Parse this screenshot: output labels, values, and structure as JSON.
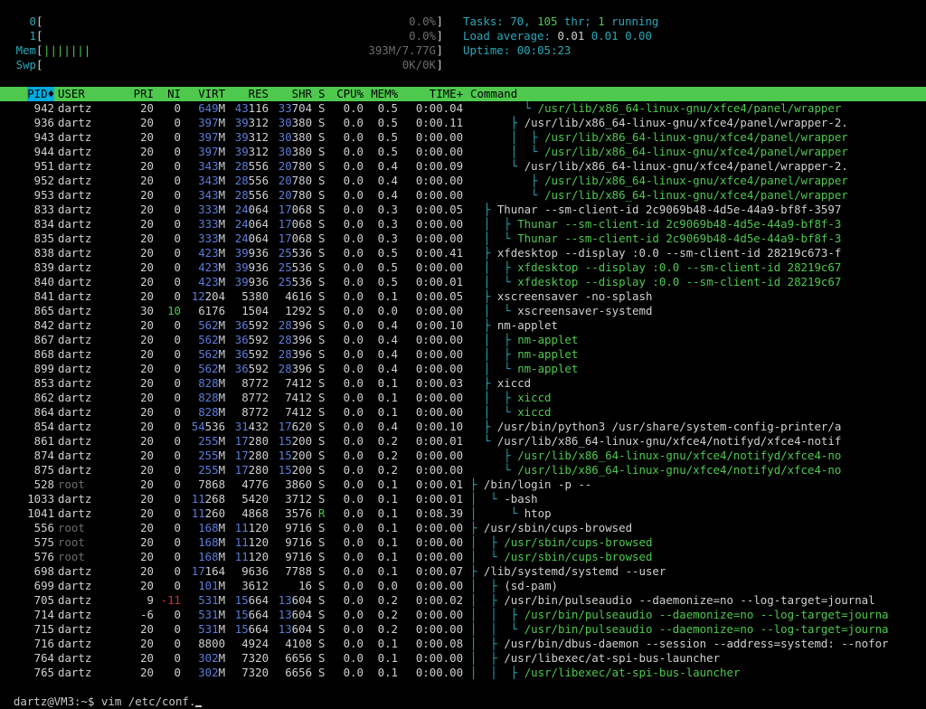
{
  "meters": [
    {
      "label": "0",
      "bar": "",
      "value": "0.0%"
    },
    {
      "label": "1",
      "bar": "",
      "value": "0.0%"
    },
    {
      "label": "Mem",
      "bar": "|||||||",
      "value": "393M/7.77G"
    },
    {
      "label": "Swp",
      "bar": "",
      "value": "0K/0K"
    }
  ],
  "summary": {
    "tasks_label": "Tasks: ",
    "tasks": "70",
    "thr": "105",
    "thr_label": " thr; ",
    "running": "1",
    "running_label": " running",
    "load_label": "Load average: ",
    "load1": "0.01",
    "load5": "0.01",
    "load15": "0.00",
    "uptime_label": "Uptime: ",
    "uptime": "00:05:23"
  },
  "columns": [
    "PID",
    "USER",
    "PRI",
    "NI",
    "VIRT",
    "RES",
    "SHR",
    "S",
    "CPU%",
    "MEM%",
    "TIME+",
    "Command"
  ],
  "sort_indicator": "♦",
  "processes": [
    {
      "pid": "942",
      "user": "dartz",
      "pri": "20",
      "ni": "0",
      "virt": "649M",
      "res": "43116",
      "shr": "33704",
      "s": "S",
      "cpu": "0.0",
      "mem": "0.5",
      "time": "0:00.04",
      "tree": "        └ ",
      "cmd": "/usr/lib/x86_64-linux-gnu/xfce4/panel/wrapper",
      "thread": true
    },
    {
      "pid": "936",
      "user": "dartz",
      "pri": "20",
      "ni": "0",
      "virt": "397M",
      "res": "39312",
      "shr": "30380",
      "s": "S",
      "cpu": "0.0",
      "mem": "0.5",
      "time": "0:00.11",
      "tree": "      ├ ",
      "cmd": "/usr/lib/x86_64-linux-gnu/xfce4/panel/wrapper-2.",
      "thread": false
    },
    {
      "pid": "943",
      "user": "dartz",
      "pri": "20",
      "ni": "0",
      "virt": "397M",
      "res": "39312",
      "shr": "30380",
      "s": "S",
      "cpu": "0.0",
      "mem": "0.5",
      "time": "0:00.00",
      "tree": "      │  ├ ",
      "cmd": "/usr/lib/x86_64-linux-gnu/xfce4/panel/wrapper",
      "thread": true
    },
    {
      "pid": "944",
      "user": "dartz",
      "pri": "20",
      "ni": "0",
      "virt": "397M",
      "res": "39312",
      "shr": "30380",
      "s": "S",
      "cpu": "0.0",
      "mem": "0.5",
      "time": "0:00.00",
      "tree": "      │  └ ",
      "cmd": "/usr/lib/x86_64-linux-gnu/xfce4/panel/wrapper",
      "thread": true
    },
    {
      "pid": "951",
      "user": "dartz",
      "pri": "20",
      "ni": "0",
      "virt": "343M",
      "res": "28556",
      "shr": "20780",
      "s": "S",
      "cpu": "0.0",
      "mem": "0.4",
      "time": "0:00.09",
      "tree": "      └ ",
      "cmd": "/usr/lib/x86_64-linux-gnu/xfce4/panel/wrapper-2.",
      "thread": false
    },
    {
      "pid": "952",
      "user": "dartz",
      "pri": "20",
      "ni": "0",
      "virt": "343M",
      "res": "28556",
      "shr": "20780",
      "s": "S",
      "cpu": "0.0",
      "mem": "0.4",
      "time": "0:00.00",
      "tree": "         ├ ",
      "cmd": "/usr/lib/x86_64-linux-gnu/xfce4/panel/wrapper",
      "thread": true
    },
    {
      "pid": "953",
      "user": "dartz",
      "pri": "20",
      "ni": "0",
      "virt": "343M",
      "res": "28556",
      "shr": "20780",
      "s": "S",
      "cpu": "0.0",
      "mem": "0.4",
      "time": "0:00.00",
      "tree": "         └ ",
      "cmd": "/usr/lib/x86_64-linux-gnu/xfce4/panel/wrapper",
      "thread": true
    },
    {
      "pid": "833",
      "user": "dartz",
      "pri": "20",
      "ni": "0",
      "virt": "333M",
      "res": "24064",
      "shr": "17068",
      "s": "S",
      "cpu": "0.0",
      "mem": "0.3",
      "time": "0:00.05",
      "tree": "  ├ ",
      "cmd": "Thunar --sm-client-id 2c9069b48-4d5e-44a9-bf8f-3597",
      "thread": false
    },
    {
      "pid": "834",
      "user": "dartz",
      "pri": "20",
      "ni": "0",
      "virt": "333M",
      "res": "24064",
      "shr": "17068",
      "s": "S",
      "cpu": "0.0",
      "mem": "0.3",
      "time": "0:00.00",
      "tree": "  │  ├ ",
      "cmd": "Thunar --sm-client-id 2c9069b48-4d5e-44a9-bf8f-3",
      "thread": true
    },
    {
      "pid": "835",
      "user": "dartz",
      "pri": "20",
      "ni": "0",
      "virt": "333M",
      "res": "24064",
      "shr": "17068",
      "s": "S",
      "cpu": "0.0",
      "mem": "0.3",
      "time": "0:00.00",
      "tree": "  │  └ ",
      "cmd": "Thunar --sm-client-id 2c9069b48-4d5e-44a9-bf8f-3",
      "thread": true
    },
    {
      "pid": "838",
      "user": "dartz",
      "pri": "20",
      "ni": "0",
      "virt": "423M",
      "res": "39936",
      "shr": "25536",
      "s": "S",
      "cpu": "0.0",
      "mem": "0.5",
      "time": "0:00.41",
      "tree": "  ├ ",
      "cmd": "xfdesktop --display :0.0 --sm-client-id 28219c673-f",
      "thread": false
    },
    {
      "pid": "839",
      "user": "dartz",
      "pri": "20",
      "ni": "0",
      "virt": "423M",
      "res": "39936",
      "shr": "25536",
      "s": "S",
      "cpu": "0.0",
      "mem": "0.5",
      "time": "0:00.00",
      "tree": "  │  ├ ",
      "cmd": "xfdesktop --display :0.0 --sm-client-id 28219c67",
      "thread": true
    },
    {
      "pid": "840",
      "user": "dartz",
      "pri": "20",
      "ni": "0",
      "virt": "423M",
      "res": "39936",
      "shr": "25536",
      "s": "S",
      "cpu": "0.0",
      "mem": "0.5",
      "time": "0:00.01",
      "tree": "  │  └ ",
      "cmd": "xfdesktop --display :0.0 --sm-client-id 28219c67",
      "thread": true
    },
    {
      "pid": "841",
      "user": "dartz",
      "pri": "20",
      "ni": "0",
      "virt": "12204",
      "res": "5380",
      "shr": "4616",
      "s": "S",
      "cpu": "0.0",
      "mem": "0.1",
      "time": "0:00.05",
      "tree": "  ├ ",
      "cmd": "xscreensaver -no-splash",
      "thread": false
    },
    {
      "pid": "865",
      "user": "dartz",
      "pri": "30",
      "ni": "10",
      "virt": "6176",
      "res": "1504",
      "shr": "1292",
      "s": "S",
      "cpu": "0.0",
      "mem": "0.0",
      "time": "0:00.00",
      "tree": "  │  └ ",
      "cmd": "xscreensaver-systemd",
      "thread": false
    },
    {
      "pid": "842",
      "user": "dartz",
      "pri": "20",
      "ni": "0",
      "virt": "562M",
      "res": "36592",
      "shr": "28396",
      "s": "S",
      "cpu": "0.0",
      "mem": "0.4",
      "time": "0:00.10",
      "tree": "  ├ ",
      "cmd": "nm-applet",
      "thread": false
    },
    {
      "pid": "867",
      "user": "dartz",
      "pri": "20",
      "ni": "0",
      "virt": "562M",
      "res": "36592",
      "shr": "28396",
      "s": "S",
      "cpu": "0.0",
      "mem": "0.4",
      "time": "0:00.00",
      "tree": "  │  ├ ",
      "cmd": "nm-applet",
      "thread": true
    },
    {
      "pid": "868",
      "user": "dartz",
      "pri": "20",
      "ni": "0",
      "virt": "562M",
      "res": "36592",
      "shr": "28396",
      "s": "S",
      "cpu": "0.0",
      "mem": "0.4",
      "time": "0:00.00",
      "tree": "  │  ├ ",
      "cmd": "nm-applet",
      "thread": true
    },
    {
      "pid": "899",
      "user": "dartz",
      "pri": "20",
      "ni": "0",
      "virt": "562M",
      "res": "36592",
      "shr": "28396",
      "s": "S",
      "cpu": "0.0",
      "mem": "0.4",
      "time": "0:00.00",
      "tree": "  │  └ ",
      "cmd": "nm-applet",
      "thread": true
    },
    {
      "pid": "853",
      "user": "dartz",
      "pri": "20",
      "ni": "0",
      "virt": "828M",
      "res": "8772",
      "shr": "7412",
      "s": "S",
      "cpu": "0.0",
      "mem": "0.1",
      "time": "0:00.03",
      "tree": "  ├ ",
      "cmd": "xiccd",
      "thread": false
    },
    {
      "pid": "862",
      "user": "dartz",
      "pri": "20",
      "ni": "0",
      "virt": "828M",
      "res": "8772",
      "shr": "7412",
      "s": "S",
      "cpu": "0.0",
      "mem": "0.1",
      "time": "0:00.00",
      "tree": "  │  ├ ",
      "cmd": "xiccd",
      "thread": true
    },
    {
      "pid": "864",
      "user": "dartz",
      "pri": "20",
      "ni": "0",
      "virt": "828M",
      "res": "8772",
      "shr": "7412",
      "s": "S",
      "cpu": "0.0",
      "mem": "0.1",
      "time": "0:00.00",
      "tree": "  │  └ ",
      "cmd": "xiccd",
      "thread": true
    },
    {
      "pid": "854",
      "user": "dartz",
      "pri": "20",
      "ni": "0",
      "virt": "54536",
      "res": "31432",
      "shr": "17620",
      "s": "S",
      "cpu": "0.0",
      "mem": "0.4",
      "time": "0:00.10",
      "tree": "  ├ ",
      "cmd": "/usr/bin/python3 /usr/share/system-config-printer/a",
      "thread": false
    },
    {
      "pid": "861",
      "user": "dartz",
      "pri": "20",
      "ni": "0",
      "virt": "255M",
      "res": "17280",
      "shr": "15200",
      "s": "S",
      "cpu": "0.0",
      "mem": "0.2",
      "time": "0:00.01",
      "tree": "  └ ",
      "cmd": "/usr/lib/x86_64-linux-gnu/xfce4/notifyd/xfce4-notif",
      "thread": false
    },
    {
      "pid": "874",
      "user": "dartz",
      "pri": "20",
      "ni": "0",
      "virt": "255M",
      "res": "17280",
      "shr": "15200",
      "s": "S",
      "cpu": "0.0",
      "mem": "0.2",
      "time": "0:00.00",
      "tree": "     ├ ",
      "cmd": "/usr/lib/x86_64-linux-gnu/xfce4/notifyd/xfce4-no",
      "thread": true
    },
    {
      "pid": "875",
      "user": "dartz",
      "pri": "20",
      "ni": "0",
      "virt": "255M",
      "res": "17280",
      "shr": "15200",
      "s": "S",
      "cpu": "0.0",
      "mem": "0.2",
      "time": "0:00.00",
      "tree": "     └ ",
      "cmd": "/usr/lib/x86_64-linux-gnu/xfce4/notifyd/xfce4-no",
      "thread": true
    },
    {
      "pid": "528",
      "user": "root",
      "pri": "20",
      "ni": "0",
      "virt": "7868",
      "res": "4776",
      "shr": "3860",
      "s": "S",
      "cpu": "0.0",
      "mem": "0.1",
      "time": "0:00.01",
      "tree": "├ ",
      "cmd": "/bin/login -p --",
      "thread": false
    },
    {
      "pid": "1033",
      "user": "dartz",
      "pri": "20",
      "ni": "0",
      "virt": "11268",
      "res": "5420",
      "shr": "3712",
      "s": "S",
      "cpu": "0.0",
      "mem": "0.1",
      "time": "0:00.01",
      "tree": "│  └ ",
      "cmd": "-bash",
      "thread": false
    },
    {
      "pid": "1041",
      "user": "dartz",
      "pri": "20",
      "ni": "0",
      "virt": "11260",
      "res": "4868",
      "shr": "3576",
      "s": "R",
      "cpu": "0.0",
      "mem": "0.1",
      "time": "0:08.39",
      "tree": "│     └ ",
      "cmd": "htop",
      "thread": false
    },
    {
      "pid": "556",
      "user": "root",
      "pri": "20",
      "ni": "0",
      "virt": "168M",
      "res": "11120",
      "shr": "9716",
      "s": "S",
      "cpu": "0.0",
      "mem": "0.1",
      "time": "0:00.00",
      "tree": "├ ",
      "cmd": "/usr/sbin/cups-browsed",
      "thread": false
    },
    {
      "pid": "575",
      "user": "root",
      "pri": "20",
      "ni": "0",
      "virt": "168M",
      "res": "11120",
      "shr": "9716",
      "s": "S",
      "cpu": "0.0",
      "mem": "0.1",
      "time": "0:00.00",
      "tree": "│  ├ ",
      "cmd": "/usr/sbin/cups-browsed",
      "thread": true
    },
    {
      "pid": "576",
      "user": "root",
      "pri": "20",
      "ni": "0",
      "virt": "168M",
      "res": "11120",
      "shr": "9716",
      "s": "S",
      "cpu": "0.0",
      "mem": "0.1",
      "time": "0:00.00",
      "tree": "│  └ ",
      "cmd": "/usr/sbin/cups-browsed",
      "thread": true
    },
    {
      "pid": "698",
      "user": "dartz",
      "pri": "20",
      "ni": "0",
      "virt": "17164",
      "res": "9636",
      "shr": "7788",
      "s": "S",
      "cpu": "0.0",
      "mem": "0.1",
      "time": "0:00.07",
      "tree": "├ ",
      "cmd": "/lib/systemd/systemd --user",
      "thread": false
    },
    {
      "pid": "699",
      "user": "dartz",
      "pri": "20",
      "ni": "0",
      "virt": "101M",
      "res": "3612",
      "shr": "16",
      "s": "S",
      "cpu": "0.0",
      "mem": "0.0",
      "time": "0:00.00",
      "tree": "│  ├ ",
      "cmd": "(sd-pam)",
      "thread": false
    },
    {
      "pid": "705",
      "user": "dartz",
      "pri": "9",
      "ni": "-11",
      "virt": "531M",
      "res": "15664",
      "shr": "13604",
      "s": "S",
      "cpu": "0.0",
      "mem": "0.2",
      "time": "0:00.02",
      "tree": "│  ├ ",
      "cmd": "/usr/bin/pulseaudio --daemonize=no --log-target=journal",
      "thread": false
    },
    {
      "pid": "714",
      "user": "dartz",
      "pri": "-6",
      "ni": "0",
      "virt": "531M",
      "res": "15664",
      "shr": "13604",
      "s": "S",
      "cpu": "0.0",
      "mem": "0.2",
      "time": "0:00.00",
      "tree": "│  │  ├ ",
      "cmd": "/usr/bin/pulseaudio --daemonize=no --log-target=journa",
      "thread": true
    },
    {
      "pid": "715",
      "user": "dartz",
      "pri": "20",
      "ni": "0",
      "virt": "531M",
      "res": "15664",
      "shr": "13604",
      "s": "S",
      "cpu": "0.0",
      "mem": "0.2",
      "time": "0:00.00",
      "tree": "│  │  └ ",
      "cmd": "/usr/bin/pulseaudio --daemonize=no --log-target=journa",
      "thread": true
    },
    {
      "pid": "716",
      "user": "dartz",
      "pri": "20",
      "ni": "0",
      "virt": "8800",
      "res": "4924",
      "shr": "4108",
      "s": "S",
      "cpu": "0.0",
      "mem": "0.1",
      "time": "0:00.08",
      "tree": "│  ├ ",
      "cmd": "/usr/bin/dbus-daemon --session --address=systemd: --nofor",
      "thread": false
    },
    {
      "pid": "764",
      "user": "dartz",
      "pri": "20",
      "ni": "0",
      "virt": "302M",
      "res": "7320",
      "shr": "6656",
      "s": "S",
      "cpu": "0.0",
      "mem": "0.1",
      "time": "0:00.00",
      "tree": "│  ├ ",
      "cmd": "/usr/libexec/at-spi-bus-launcher",
      "thread": false
    },
    {
      "pid": "765",
      "user": "dartz",
      "pri": "20",
      "ni": "0",
      "virt": "302M",
      "res": "7320",
      "shr": "6656",
      "s": "S",
      "cpu": "0.0",
      "mem": "0.1",
      "time": "0:00.00",
      "tree": "│  │  ├ ",
      "cmd": "/usr/libexec/at-spi-bus-launcher",
      "thread": true
    }
  ],
  "prompt": {
    "text": "dartz@VM3:~$ vim /etc/conf."
  },
  "colors": {
    "background": "#000000",
    "header_bar": "#4ec94e",
    "sorted_column": "#00aadd",
    "thread": "#4ec94e",
    "tree": "#2aa8b8",
    "meter_label": "#2aa8b8",
    "summary_value": "#2aa8b8",
    "mem_big": "#5c7cd8",
    "high_priority": "#d03030"
  }
}
